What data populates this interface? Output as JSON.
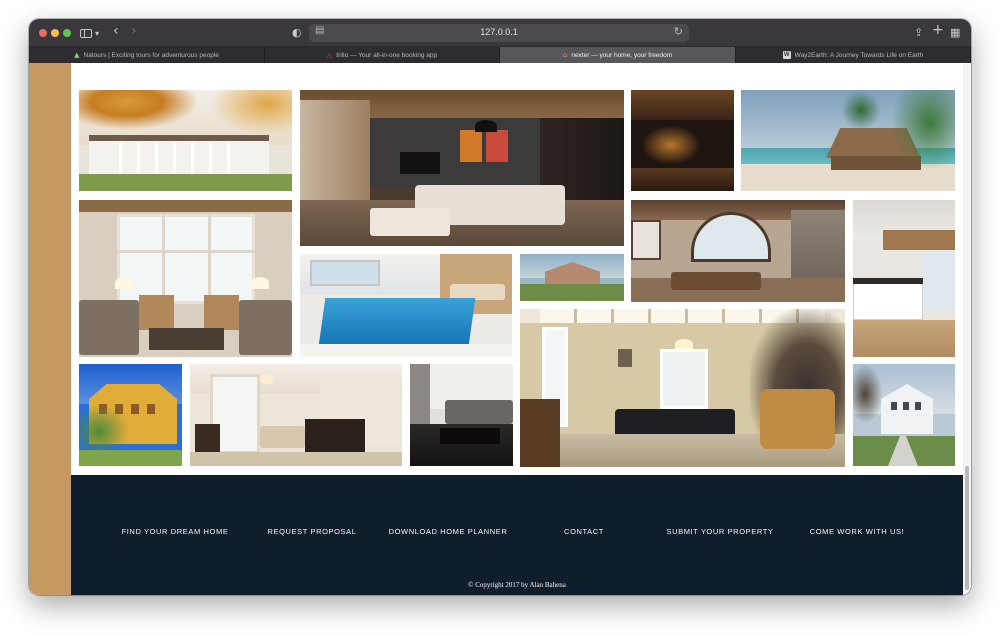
{
  "browser": {
    "url": "127.0.0.1",
    "tabs": [
      {
        "label": "Natours | Exciting tours for adventurous people",
        "icon": "natours-favicon-icon"
      },
      {
        "label": "trillo — Your all-in-one booking app",
        "icon": "trillo-favicon-icon"
      },
      {
        "label": "nexter — your home, your freedom",
        "icon": "nexter-favicon-icon"
      },
      {
        "label": "Way2Earth: A Journey Towards Life on Earth",
        "icon": "way2earth-favicon-icon",
        "badge": "W"
      }
    ],
    "active_tab": 2
  },
  "gallery": {
    "photos": [
      {
        "name": "gallery-photo-1",
        "alt": "White mansion with autumn trees"
      },
      {
        "name": "gallery-photo-2",
        "alt": "Modern living room with wooden ceiling"
      },
      {
        "name": "gallery-photo-3",
        "alt": "Dark interior with warm lights"
      },
      {
        "name": "gallery-photo-4",
        "alt": "Beach resort with palm trees"
      },
      {
        "name": "gallery-photo-5",
        "alt": "Bright living room with tall windows"
      },
      {
        "name": "gallery-photo-6",
        "alt": "Indoor swimming pool"
      },
      {
        "name": "gallery-photo-7",
        "alt": "Country house exterior"
      },
      {
        "name": "gallery-photo-8",
        "alt": "Open living area with stone fireplace"
      },
      {
        "name": "gallery-photo-9",
        "alt": "White modern kitchen"
      },
      {
        "name": "gallery-photo-10",
        "alt": "Billiard room with spiral staircase"
      },
      {
        "name": "gallery-photo-11",
        "alt": "Yellow Mediterranean villa"
      },
      {
        "name": "gallery-photo-12",
        "alt": "Elegant dining and living room"
      },
      {
        "name": "gallery-photo-13",
        "alt": "Dark living room with sofa"
      },
      {
        "name": "gallery-photo-14",
        "alt": "White villa with path"
      }
    ]
  },
  "footer": {
    "links": [
      "Find your dream home",
      "Request proposal",
      "Download home planner",
      "Contact",
      "Submit your property",
      "Come work with us!"
    ],
    "copyright": "© Copyright 2017 by Alan Bahena"
  },
  "colors": {
    "accent": "#c69963",
    "footer_bg": "#101d2c"
  }
}
